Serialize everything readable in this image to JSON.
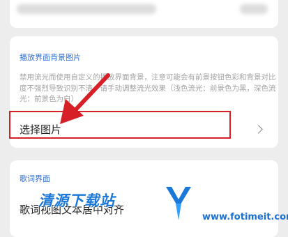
{
  "sections": {
    "background": {
      "title": "播放界面背景图片",
      "description": "禁用流光而使用自定义的播放界面背景，注意可能会有前景按钮色彩和背景对比度不强烈导致识别不清，请手动调整流光效果（浅色流光：前景色为黑，深色流光：前景色为白）",
      "select_label": "选择图片"
    },
    "lyric": {
      "title": "歌词界面",
      "center_label": "歌词视图文本居中对齐"
    }
  },
  "watermark": {
    "title": "清源下载站",
    "url": "www.fotimeit.com"
  },
  "colors": {
    "accent": "#2f6fd6",
    "highlight": "#d61f27",
    "watermark": "#1a78d8"
  }
}
